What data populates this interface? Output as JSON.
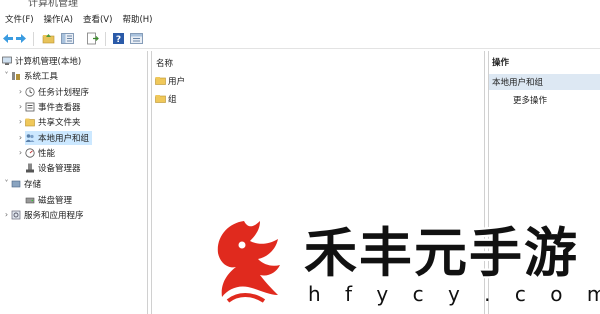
{
  "window": {
    "title": "计算机管理"
  },
  "menu": [
    "文件(F)",
    "操作(A)",
    "查看(V)",
    "帮助(H)"
  ],
  "toolbar": {
    "icons": [
      "back-arrow-icon",
      "forward-arrow-icon",
      "up-folder-icon",
      "show-tree-icon",
      "export-list-icon",
      "help-icon",
      "properties-icon"
    ]
  },
  "tree": {
    "root": "计算机管理(本地)",
    "system_tools": "系统工具",
    "task_scheduler": "任务计划程序",
    "event_viewer": "事件查看器",
    "shared_folders": "共享文件夹",
    "local_users": "本地用户和组",
    "performance": "性能",
    "device_manager": "设备管理器",
    "storage": "存储",
    "disk_management": "磁盘管理",
    "services_apps": "服务和应用程序"
  },
  "main": {
    "column_header": "名称",
    "items": [
      "用户",
      "组"
    ]
  },
  "actions": {
    "header": "操作",
    "section": "本地用户和组",
    "more": "更多操作"
  },
  "watermark": {
    "text": "禾丰元手游",
    "url": "h f y c y . c o m"
  },
  "colors": {
    "selection": "#cce8ff",
    "actions_section_bg": "#dde8f3",
    "logo_red": "#e02a1e",
    "folder_yellow": "#f0c85a"
  }
}
